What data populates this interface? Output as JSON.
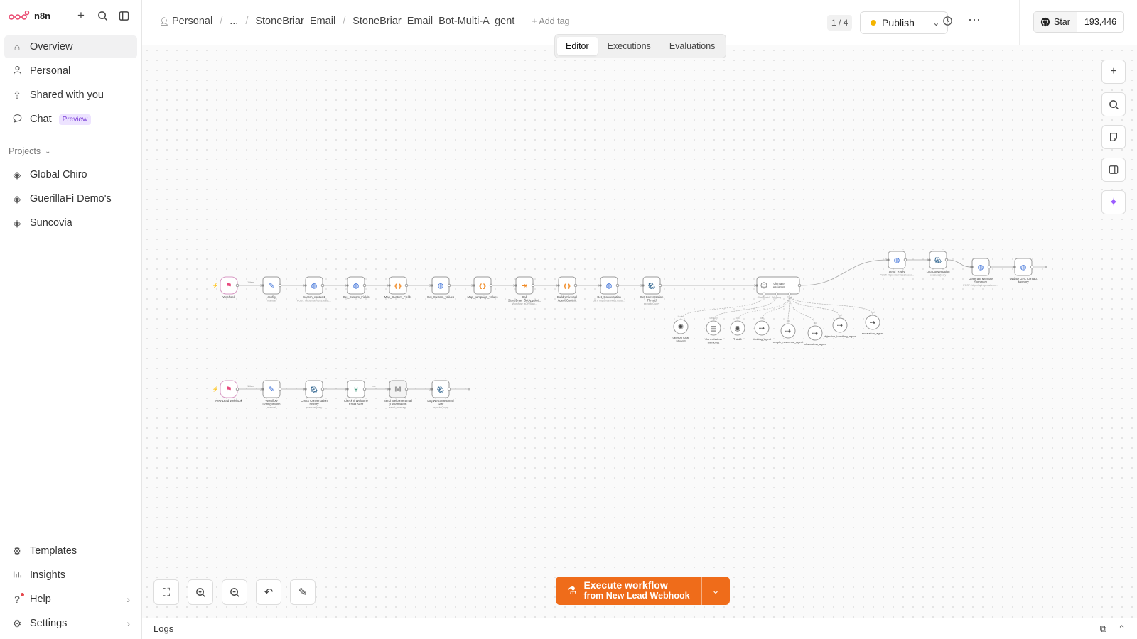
{
  "app": {
    "name": "n8n"
  },
  "sidebar": {
    "nav": [
      {
        "label": "Overview",
        "icon": "home-icon"
      },
      {
        "label": "Personal",
        "icon": "user-icon"
      },
      {
        "label": "Shared with you",
        "icon": "share-icon"
      },
      {
        "label": "Chat",
        "icon": "chat-icon",
        "badge": "Preview"
      }
    ],
    "projects_label": "Projects",
    "projects": [
      "Global Chiro",
      "GuerillaFi Demo's",
      "Suncovia"
    ],
    "bottom": [
      {
        "label": "Templates",
        "icon": "templates-icon"
      },
      {
        "label": "Insights",
        "icon": "insights-icon"
      },
      {
        "label": "Help",
        "icon": "help-icon"
      },
      {
        "label": "Settings",
        "icon": "settings-icon"
      }
    ]
  },
  "header": {
    "breadcrumb": [
      "Personal",
      "...",
      "StoneBriar_Email"
    ],
    "workflow_name": "StoneBriar_Email_Bot-Multi-A  gent",
    "add_tag": "+ Add tag",
    "tabs": [
      "Editor",
      "Executions",
      "Evaluations"
    ],
    "active_tab": "Editor",
    "version": "1 / 4",
    "publish": "Publish",
    "publish_status_color": "#f4b400",
    "github_star": "Star",
    "github_count": "193,446"
  },
  "workflow1": {
    "nodes": [
      {
        "label": "Webhook",
        "sub": "",
        "icon": "webhook-icon"
      },
      {
        "label": "config",
        "sub": "manual",
        "icon": "edit-icon"
      },
      {
        "label": "Search_contact1",
        "sub": "POST: https://services.leadc...",
        "icon": "globe-icon"
      },
      {
        "label": "Get_Custom_Fields",
        "sub": "",
        "icon": "globe-icon"
      },
      {
        "label": "Map_Custom_Fields",
        "sub": "",
        "icon": "code-icon"
      },
      {
        "label": "Get_Custom_Values",
        "sub": "",
        "icon": "globe-icon"
      },
      {
        "label": "Map_campaign_values",
        "sub": "",
        "icon": "code-icon"
      },
      {
        "label": "Call StoneBriar_GetAppoint...",
        "sub": "Workflow: aOtVBqw...",
        "icon": "subworkflow-icon"
      },
      {
        "label": "Build Universal Agent Context",
        "sub": "",
        "icon": "code-icon"
      },
      {
        "label": "Get_Conversation",
        "sub": "GET: https://services.leadc...",
        "icon": "globe-icon"
      },
      {
        "label": "Get Conversation Thread",
        "sub": "executeQuery",
        "icon": "postgres-icon"
      }
    ],
    "agent": {
      "label": "Ultimate Assistant",
      "ports": [
        "Chat Model*",
        "Memory",
        "Tool"
      ]
    },
    "sub_nodes": [
      {
        "label": "OpenAI Chat Model3",
        "port": "Model",
        "icon": "openai-icon"
      },
      {
        "label": "Conversation Memory1",
        "port": "Memory",
        "icon": "memory-icon"
      },
      {
        "label": "Think1",
        "port": "Tool",
        "icon": "think-icon"
      },
      {
        "label": "booking_agent",
        "port": "Tool",
        "icon": "tool-icon"
      },
      {
        "label": "simple_response_agent",
        "port": "Tool",
        "icon": "tool-icon"
      },
      {
        "label": "information_agent",
        "port": "Tool",
        "icon": "tool-icon"
      },
      {
        "label": "objection_handling_agent",
        "port": "Tool",
        "icon": "tool-icon"
      },
      {
        "label": "escalation_agent",
        "port": "Tool",
        "icon": "tool-icon"
      }
    ],
    "after_nodes": [
      {
        "label": "Send_Reply",
        "sub": "POST: https://services.leadc...",
        "icon": "globe-icon"
      },
      {
        "label": "Log Conversation",
        "sub": "executeQuery",
        "icon": "postgres-icon"
      },
      {
        "label": "Generate Memory Summary",
        "sub": "POST: https://api.openai.com...",
        "icon": "globe-icon"
      },
      {
        "label": "Update GHL Contact Memory",
        "sub": "",
        "icon": "globe-icon"
      }
    ],
    "edge_label": "1 item"
  },
  "workflow2": {
    "nodes": [
      {
        "label": "New Lead Webhook",
        "sub": "",
        "icon": "webhook-icon"
      },
      {
        "label": "Workflow Configuration",
        "sub": "manual",
        "icon": "edit-icon"
      },
      {
        "label": "Check Conversation History",
        "sub": "executeQuery",
        "icon": "postgres-icon"
      },
      {
        "label": "Check If Welcome Email Sent",
        "sub": "",
        "icon": "if-icon"
      },
      {
        "label": "Send Welcome Email (Deactivated)",
        "sub": "send: message",
        "icon": "gmail-icon"
      },
      {
        "label": "Log Welcome Email Sent",
        "sub": "executeQuery",
        "icon": "postgres-icon"
      }
    ],
    "edge_label": "1 item",
    "branch_label": "true"
  },
  "canvas_tools": {
    "right": [
      "plus-icon",
      "search-icon",
      "sticky-note-icon",
      "panel-icon",
      "ai-sparkle-icon"
    ],
    "bottom": [
      "fit-view-icon",
      "zoom-in-icon",
      "zoom-out-icon",
      "undo-icon",
      "tidy-icon"
    ]
  },
  "execute": {
    "title": "Execute workflow",
    "subtitle": "from New Lead Webhook",
    "color": "#ef6c1a"
  },
  "logs": {
    "label": "Logs"
  }
}
